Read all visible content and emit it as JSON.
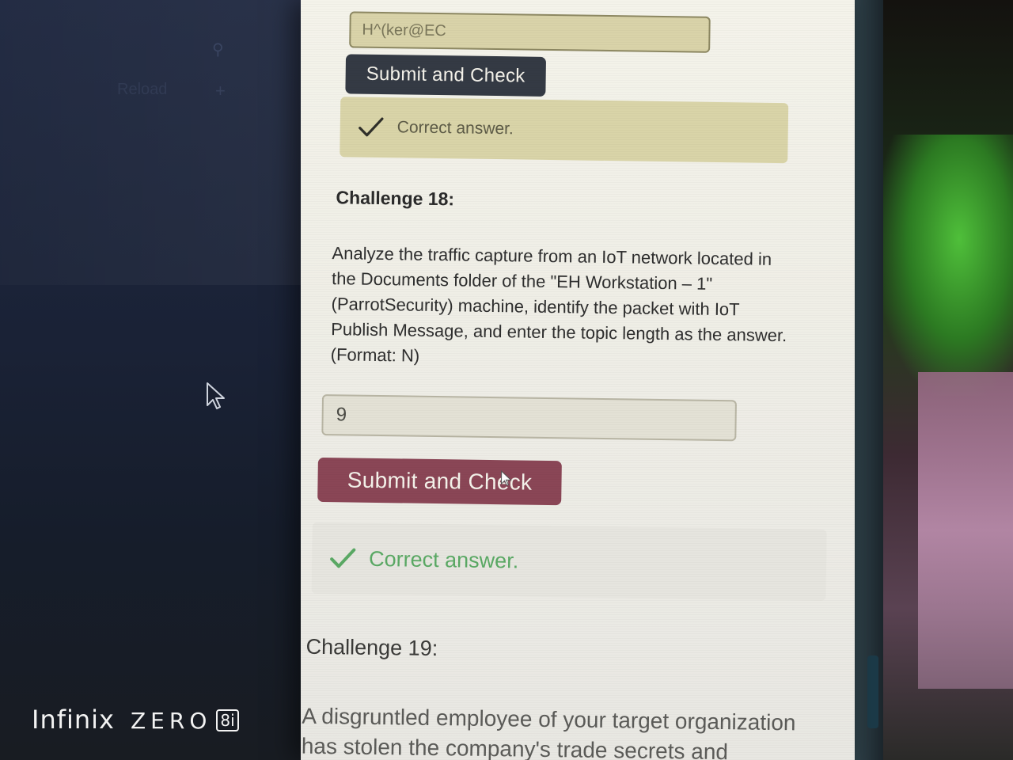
{
  "background": {
    "left_sidebar": {
      "reload_label": "Reload",
      "plus_label": "+"
    }
  },
  "challenge_17": {
    "answer_value": "H^(ker@EC",
    "submit_label": "Submit and Check",
    "feedback": "Correct answer."
  },
  "challenge_18": {
    "title": "Challenge 18:",
    "question": "Analyze the traffic capture from an IoT network located in the Documents folder of the \"EH Workstation – 1\" (ParrotSecurity) machine, identify the packet with IoT Publish Message, and enter the topic length as the answer. (Format: N)",
    "answer_value": "9",
    "submit_label": "Submit and Check",
    "feedback": "Correct answer."
  },
  "challenge_19": {
    "title": "Challenge 19:",
    "question_partial": "A disgruntled employee of your target organization has stolen the company's trade secrets and"
  },
  "watermark": {
    "brand": "Infinix",
    "model": "ZERO",
    "badge": "8i"
  },
  "colors": {
    "dark_button": "#343a44",
    "primary_button": "#8a4656",
    "success_green": "#5aa964",
    "feedback_bg": "#d9d4a8"
  },
  "icons": {
    "check": "check-icon",
    "mouse_cursor": "arrow-cursor-icon",
    "pointer_cursor": "pointer-cursor-icon",
    "search": "search-icon"
  }
}
